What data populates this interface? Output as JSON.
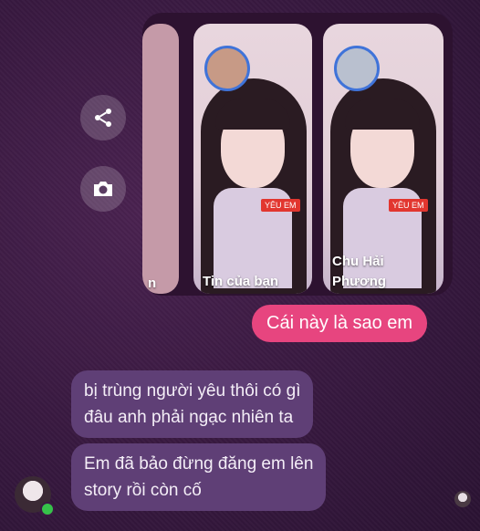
{
  "stories": [
    {
      "label": "Tin của bạn",
      "tag": "YÊU EM"
    },
    {
      "label_line1": "Chu Hải",
      "label_line2": "Phương",
      "tag": "YÊU EM"
    }
  ],
  "partial_card_letter": "n",
  "messages": {
    "sent": "Cái này là sao em",
    "received_1_line1": "bị trùng người yêu thôi có gì",
    "received_1_line2": "đâu anh phải ngạc nhiên ta",
    "received_2_line1": "Em đã bảo đừng đăng em lên",
    "received_2_line2": "story rồi còn cố"
  },
  "colors": {
    "sent_bubble": "#e7457f",
    "received_bubble": "#5f3f76",
    "story_ring": "#3f73d9",
    "online": "#36c24a"
  },
  "icons": [
    "share-icon",
    "camera-icon"
  ]
}
